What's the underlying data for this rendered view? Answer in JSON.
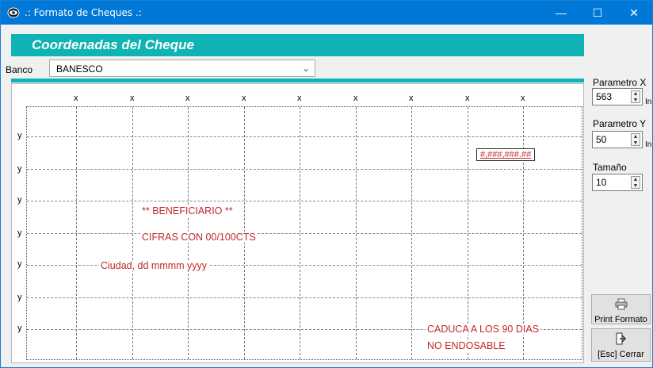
{
  "window": {
    "title": ".: Formato de Cheques .:",
    "minimize_glyph": "—",
    "maximize_glyph": "☐",
    "close_glyph": "✕"
  },
  "header": {
    "title": "Coordenadas del Cheque"
  },
  "banco": {
    "label": "Banco",
    "selected": "BANESCO"
  },
  "grid": {
    "x_label": "x",
    "y_label": "y"
  },
  "fields": {
    "amount": "#,###,###.##",
    "beneficiary": "** BENEFICIARIO **",
    "amount_words": "CIFRAS CON 00/100CTS",
    "city_date": "Ciudad, dd mmmm yyyy",
    "expiry": "CADUCA A LOS 90 DIAS",
    "non_endorsable": "NO ENDOSABLE"
  },
  "params": {
    "x_label": "Parametro X",
    "x_value": "563",
    "x_unit": "In",
    "y_label": "Parametro Y",
    "y_value": "50",
    "y_unit": "In",
    "size_label": "Tamaño",
    "size_value": "10"
  },
  "buttons": {
    "print_label": "Print Formato",
    "close_label": "[Esc] Cerrar"
  },
  "icons": {
    "app": "eye-icon",
    "print": "printer-icon",
    "close": "exit-door-icon",
    "spin": "spinner-arrows-icon",
    "dropdown": "chevron-down-icon"
  },
  "colors": {
    "titlebar": "#0078d7",
    "header_band": "#10b3b3",
    "field_text": "#c0282a"
  }
}
